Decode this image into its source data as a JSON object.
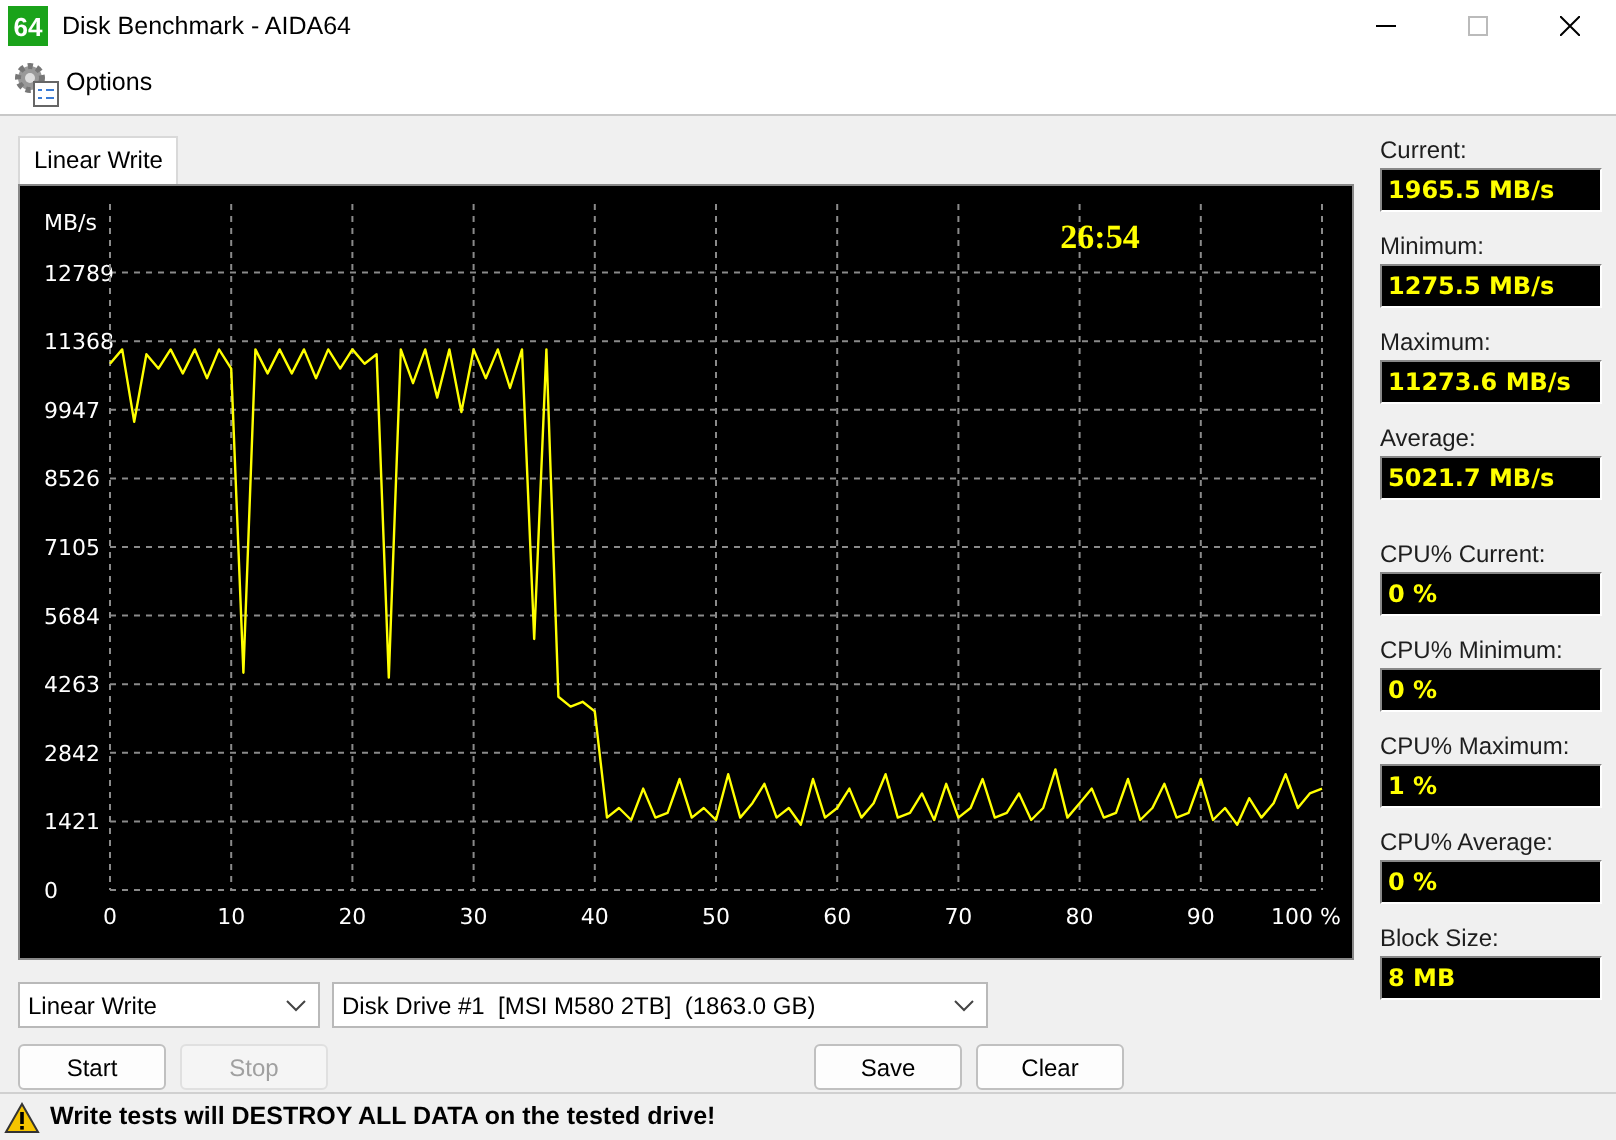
{
  "window": {
    "title": "Disk Benchmark - AIDA64",
    "app_icon_text": "64"
  },
  "menu": [
    {
      "label": "Options"
    }
  ],
  "tabs": [
    {
      "label": "Linear Write",
      "selected": true
    }
  ],
  "chart": {
    "elapsed": "26:54",
    "chart_data": {
      "type": "line",
      "grid": true,
      "ylabel": "MB/s",
      "xlim": [
        0,
        100
      ],
      "ylim": [
        0,
        14210
      ],
      "yticks": [
        0,
        1421,
        2842,
        4263,
        5684,
        7105,
        8526,
        9947,
        11368,
        12789
      ],
      "xticks": [
        0,
        10,
        20,
        30,
        40,
        50,
        60,
        70,
        80,
        90,
        {
          "value": 100,
          "label": "100 %"
        }
      ],
      "x": [
        0,
        1,
        2,
        3,
        4,
        5,
        6,
        7,
        8,
        9,
        10,
        11,
        12,
        13,
        14,
        15,
        16,
        17,
        18,
        19,
        20,
        21,
        22,
        23,
        24,
        25,
        26,
        27,
        28,
        29,
        30,
        31,
        32,
        33,
        34,
        35,
        36,
        37,
        38,
        39,
        40,
        41,
        42,
        43,
        44,
        45,
        46,
        47,
        48,
        49,
        50,
        51,
        52,
        53,
        54,
        55,
        56,
        57,
        58,
        59,
        60,
        61,
        62,
        63,
        64,
        65,
        66,
        67,
        68,
        69,
        70,
        71,
        72,
        73,
        74,
        75,
        76,
        77,
        78,
        79,
        80,
        81,
        82,
        83,
        84,
        85,
        86,
        87,
        88,
        89,
        90,
        91,
        92,
        93,
        94,
        95,
        96,
        97,
        98,
        99,
        100
      ],
      "series": [
        {
          "color": "#ffff00",
          "values": [
            10900,
            11200,
            9700,
            11100,
            10800,
            11200,
            10700,
            11200,
            10600,
            11200,
            10800,
            4500,
            11200,
            10700,
            11200,
            10700,
            11200,
            10600,
            11200,
            10800,
            11200,
            10900,
            11100,
            4400,
            11200,
            10500,
            11200,
            10200,
            11200,
            9900,
            11200,
            10600,
            11200,
            10400,
            11200,
            5200,
            11200,
            4000,
            3800,
            3900,
            3700,
            1500,
            1700,
            1450,
            2100,
            1500,
            1600,
            2300,
            1500,
            1700,
            1450,
            2400,
            1500,
            1800,
            2200,
            1500,
            1700,
            1350,
            2300,
            1500,
            1700,
            2100,
            1500,
            1800,
            2400,
            1500,
            1600,
            2000,
            1450,
            2200,
            1500,
            1700,
            2300,
            1500,
            1600,
            2000,
            1450,
            1700,
            2500,
            1500,
            1800,
            2100,
            1500,
            1600,
            2300,
            1450,
            1700,
            2200,
            1500,
            1600,
            2300,
            1450,
            1700,
            1350,
            1900,
            1500,
            1800,
            2400,
            1700,
            2000,
            2100
          ]
        }
      ]
    }
  },
  "stat_groups": [
    {
      "items": [
        {
          "label": "Current:",
          "value": "1965.5 MB/s"
        },
        {
          "label": "Minimum:",
          "value": "1275.5 MB/s"
        },
        {
          "label": "Maximum:",
          "value": "11273.6 MB/s"
        },
        {
          "label": "Average:",
          "value": "5021.7 MB/s"
        }
      ]
    },
    {
      "items": [
        {
          "label": "CPU% Current:",
          "value": "0 %"
        },
        {
          "label": "CPU% Minimum:",
          "value": "0 %"
        },
        {
          "label": "CPU% Maximum:",
          "value": "1 %"
        },
        {
          "label": "CPU% Average:",
          "value": "0 %"
        },
        {
          "label": "Block Size:",
          "value": "8 MB"
        }
      ]
    }
  ],
  "test_select": {
    "value": "Linear Write"
  },
  "drive_select": {
    "value": "Disk Drive #1  [MSI M580 2TB]  (1863.0 GB)"
  },
  "run_buttons": [
    {
      "label": "Start",
      "disabled": false
    },
    {
      "label": "Stop",
      "disabled": true
    }
  ],
  "result_buttons": [
    {
      "label": "Save",
      "disabled": false
    },
    {
      "label": "Clear",
      "disabled": false
    }
  ],
  "status_bar": {
    "text": "Write tests will DESTROY ALL DATA on the tested drive!"
  }
}
